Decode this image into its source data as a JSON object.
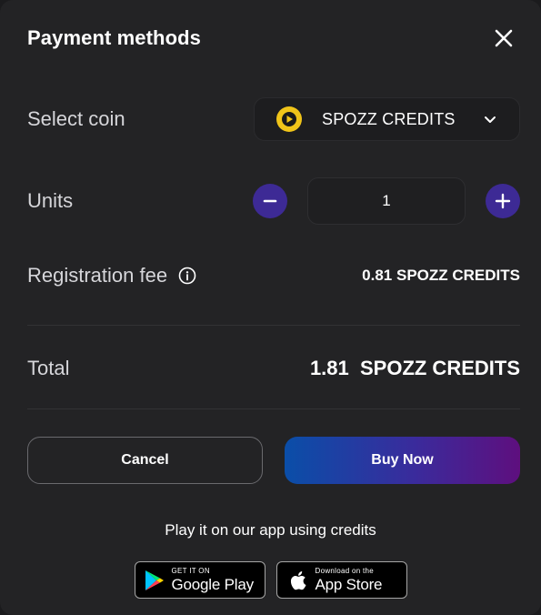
{
  "header": {
    "title": "Payment methods"
  },
  "select_coin": {
    "label": "Select coin",
    "value": "SPOZZ CREDITS"
  },
  "units": {
    "label": "Units",
    "value": "1"
  },
  "registration_fee": {
    "label": "Registration fee",
    "value": "0.81 SPOZZ CREDITS"
  },
  "total": {
    "label": "Total",
    "value": "1.81  SPOZZ CREDITS"
  },
  "actions": {
    "cancel_label": "Cancel",
    "buy_label": "Buy Now"
  },
  "app_promo": {
    "text": "Play it on our app using credits",
    "google_play": {
      "small": "GET IT ON",
      "big": "Google Play"
    },
    "app_store": {
      "small": "Download on the",
      "big": "App Store"
    }
  },
  "colors": {
    "background": "#232325",
    "accent_round": "#3d2a95",
    "coin": "#f0c419",
    "buy_gradient_start": "#0a4ea8",
    "buy_gradient_end": "#5e0f7e"
  },
  "icons": [
    "close-icon",
    "coin-icon",
    "chevron-down-icon",
    "minus-icon",
    "plus-icon",
    "info-icon",
    "google-play-icon",
    "apple-icon"
  ]
}
